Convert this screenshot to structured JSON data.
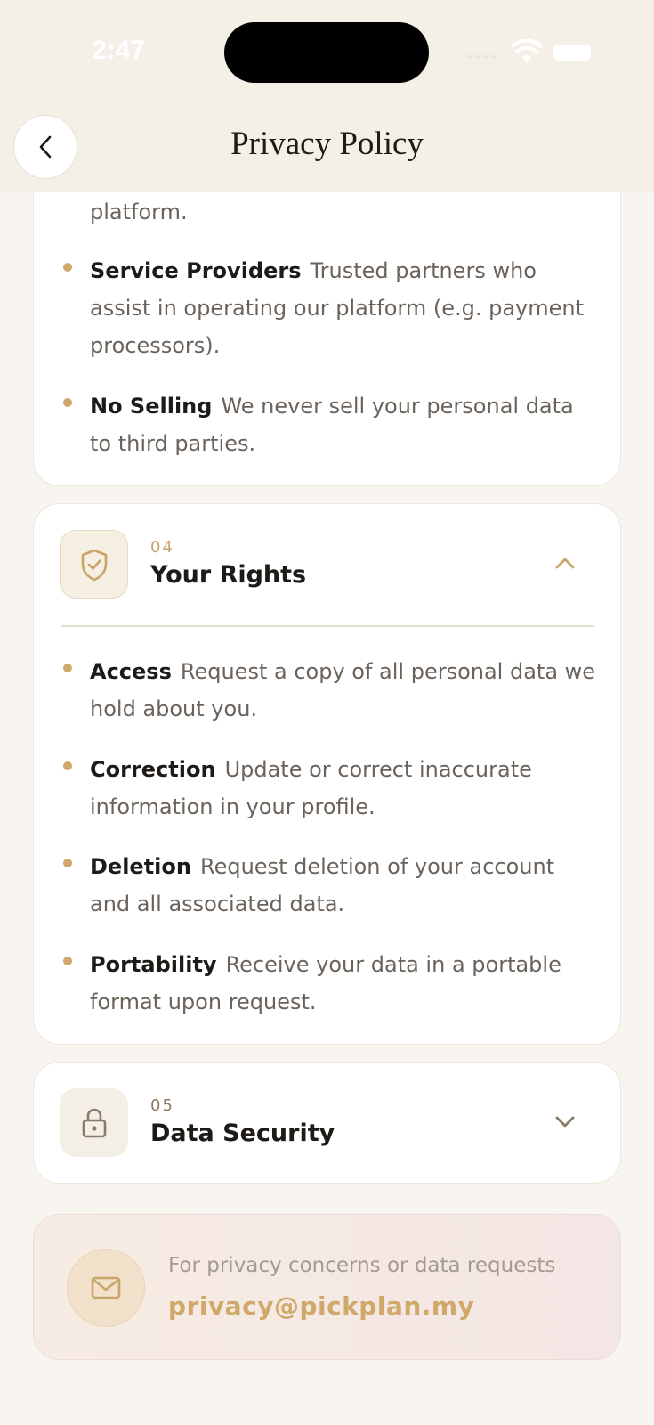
{
  "status_bar": {
    "time": "2:47"
  },
  "header": {
    "title": "Privacy Policy"
  },
  "sharing_section": {
    "partial_text": "platform.",
    "items": [
      {
        "title": "Service Providers",
        "text": "Trusted partners who assist in operating our platform (e.g. payment processors)."
      },
      {
        "title": "No Selling",
        "text": "We never sell your personal data to third parties."
      }
    ]
  },
  "rights_section": {
    "number": "04",
    "title": "Your Rights",
    "icon": "shield-check-icon",
    "expanded": true,
    "items": [
      {
        "title": "Access",
        "text": "Request a copy of all personal data we hold about you."
      },
      {
        "title": "Correction",
        "text": "Update or correct inaccurate information in your profile."
      },
      {
        "title": "Deletion",
        "text": "Request deletion of your account and all associated data."
      },
      {
        "title": "Portability",
        "text": "Receive your data in a portable format upon request."
      }
    ]
  },
  "security_section": {
    "number": "05",
    "title": "Data Security",
    "icon": "lock-icon",
    "expanded": false
  },
  "contact": {
    "text": "For privacy concerns or data requests",
    "email": "privacy@pickplan.my",
    "icon": "mail-icon"
  },
  "colors": {
    "accent": "#cfa86a",
    "background": "#f8f5f0",
    "header_bg": "#f4f0e8",
    "text_primary": "#1d1a17",
    "text_secondary": "#6b635b"
  }
}
